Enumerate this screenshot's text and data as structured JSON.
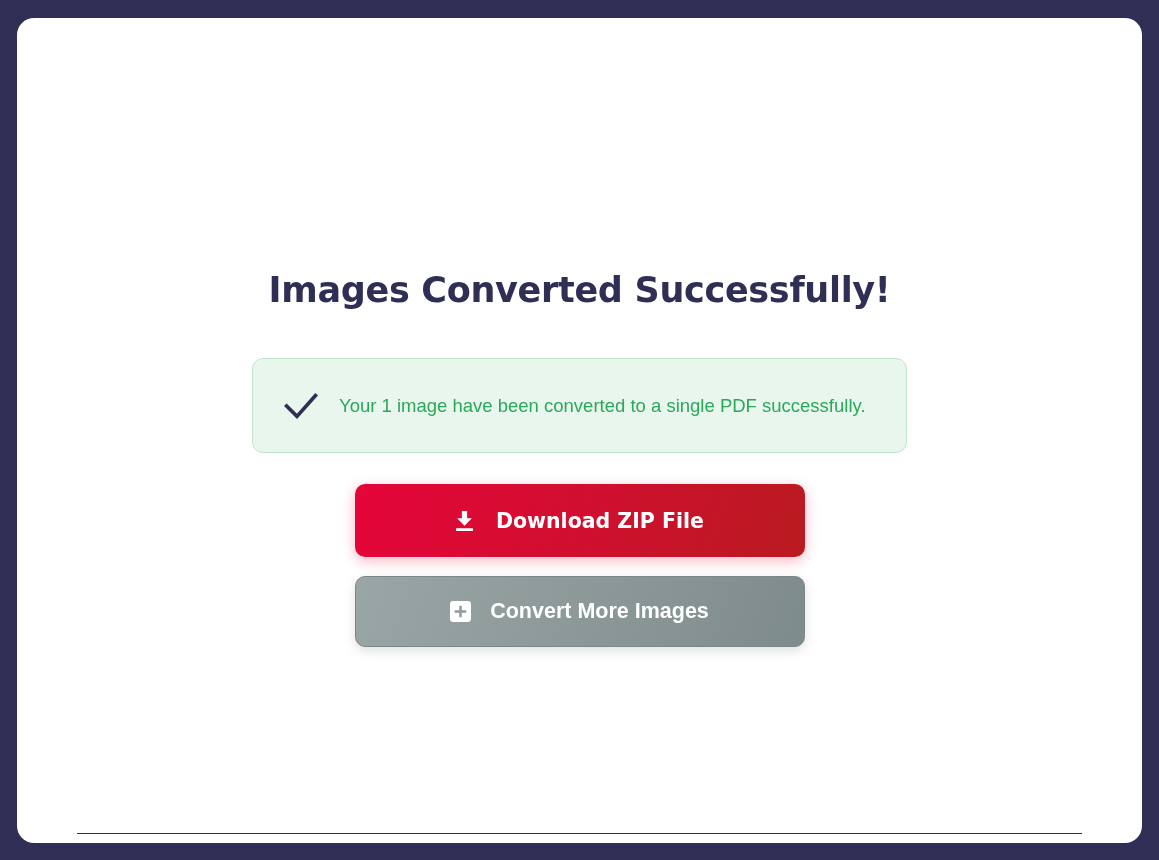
{
  "dialog": {
    "title": "Images Converted Successfully!",
    "message": {
      "text": "Your 1 image have been converted to a single PDF successfully."
    },
    "buttons": [
      {
        "label": "Download ZIP File",
        "kind": "primary"
      },
      {
        "label": "Convert More Images",
        "kind": "secondary"
      }
    ]
  }
}
